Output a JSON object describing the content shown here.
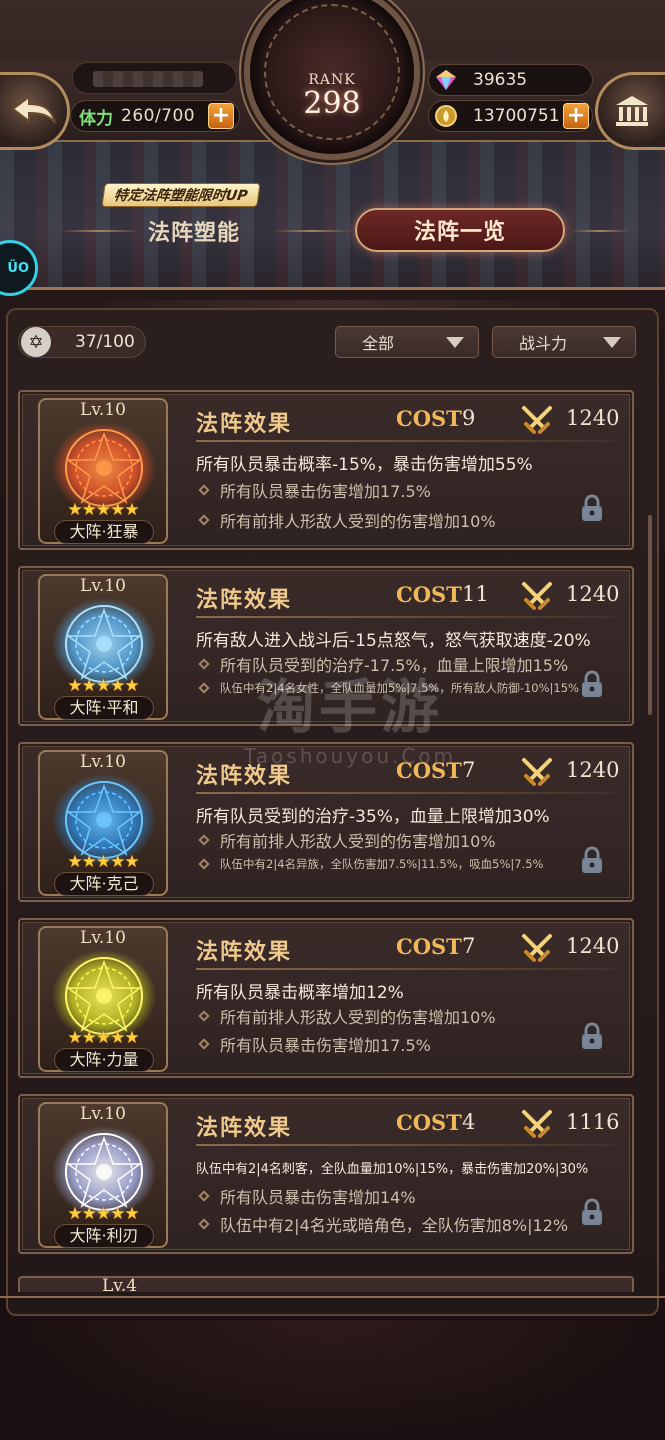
{
  "header": {
    "rank_label": "RANK",
    "rank_value": "298",
    "stamina_label": "体力",
    "stamina_value": "260/700",
    "gems": "39635",
    "gold": "13700751",
    "promo_badge": "特定法阵塑能限时UP",
    "tabs": {
      "left": "法阵塑能",
      "right": "法阵一览"
    },
    "avatar_badge": "ÜO\nAY"
  },
  "toolbar": {
    "count": "37/100",
    "filter_label": "全部",
    "sort_label": "战斗力"
  },
  "watermark": {
    "big": "淘手游",
    "small": "Taoshouyou.Com"
  },
  "cards": [
    {
      "level": "Lv.10",
      "stars": "★★★★★",
      "name": "大阵·狂暴",
      "title": "法阵效果",
      "cost_label": "COST",
      "cost": "9",
      "power": "1240",
      "main": "所有队员暴击概率-15%，暴击伤害增加55%",
      "subs": [
        "所有队员暴击伤害增加17.5%",
        "所有前排人形敌人受到的伤害增加10%"
      ],
      "color": "#ff5a2a",
      "glow": "#ff9a4a"
    },
    {
      "level": "Lv.10",
      "stars": "★★★★★",
      "name": "大阵·平和",
      "title": "法阵效果",
      "cost_label": "COST",
      "cost": "11",
      "power": "1240",
      "main": "所有敌人进入战斗后-15点怒气，怒气获取速度-20%",
      "subs": [
        "所有队员受到的治疗-17.5%，血量上限增加15%",
        "队伍中有2|4名女性，全队血量加5%|7.5%，所有敌人防御-10%|15%"
      ],
      "color": "#57b8ff",
      "glow": "#a9e2ff"
    },
    {
      "level": "Lv.10",
      "stars": "★★★★★",
      "name": "大阵·克己",
      "title": "法阵效果",
      "cost_label": "COST",
      "cost": "7",
      "power": "1240",
      "main": "所有队员受到的治疗-35%，血量上限增加30%",
      "subs": [
        "所有前排人形敌人受到的伤害增加10%",
        "队伍中有2|4名异族，全队伤害加7.5%|11.5%，吸血5%|7.5%"
      ],
      "color": "#2a8fe8",
      "glow": "#6cc8ff"
    },
    {
      "level": "Lv.10",
      "stars": "★★★★★",
      "name": "大阵·力量",
      "title": "法阵效果",
      "cost_label": "COST",
      "cost": "7",
      "power": "1240",
      "main": "所有队员暴击概率增加12%",
      "subs": [
        "所有前排人形敌人受到的伤害增加10%",
        "所有队员暴击伤害增加17.5%"
      ],
      "color": "#d9e022",
      "glow": "#fff76a"
    },
    {
      "level": "Lv.10",
      "stars": "★★★★★",
      "name": "大阵·利刃",
      "title": "法阵效果",
      "cost_label": "COST",
      "cost": "4",
      "power": "1116",
      "main": "队伍中有2|4名刺客，全队血量加10%|15%，暴击伤害加20%|30%",
      "subs": [
        "所有队员暴击伤害增加14%",
        "队伍中有2|4名光或暗角色，全队伤害加8%|12%"
      ],
      "color": "#b6c2ff",
      "glow": "#ffffff"
    }
  ],
  "partial_card": {
    "level": "Lv.4"
  }
}
